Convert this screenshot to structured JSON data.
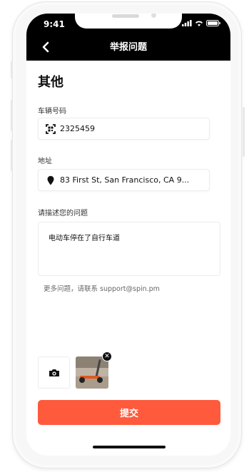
{
  "status_bar": {
    "time": "9:41"
  },
  "nav": {
    "title": "举报问题",
    "back_icon": "chevron-left-icon"
  },
  "page": {
    "title": "其他"
  },
  "fields": {
    "vehicle_label": "车辆号码",
    "vehicle_value": "2325459",
    "vehicle_icon": "qr-scan-icon",
    "address_label": "地址",
    "address_value": "83 First St, San Francisco, CA  9...",
    "address_icon": "location-pin-icon",
    "description_label": "请描述您的问题",
    "description_value": "电动车停在了自行车道"
  },
  "help_text": "更多问题，请联系 support@spin.pm",
  "attachments": {
    "camera_icon": "camera-icon",
    "remove_icon": "close-icon"
  },
  "submit": {
    "label": "提交"
  },
  "colors": {
    "accent": "#ff5a3c",
    "nav_bg": "#000000"
  }
}
